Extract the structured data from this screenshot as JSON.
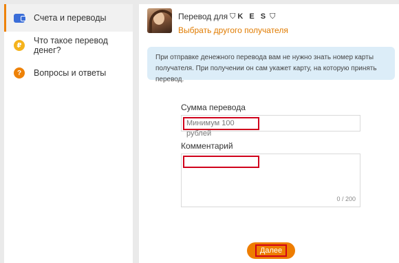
{
  "sidebar": {
    "items": [
      {
        "label": "Счета и переводы",
        "icon": "wallet-icon",
        "active": true
      },
      {
        "label": "Что такое перевод денег?",
        "icon": "ruble-icon",
        "glyph": "₽"
      },
      {
        "label": "Вопросы и ответы",
        "icon": "question-icon",
        "glyph": "?"
      }
    ]
  },
  "recipient": {
    "prefix": "Перевод для",
    "name": "K E S",
    "shield": "⛉",
    "change_link": "Выбрать другого получателя"
  },
  "info_text": "При отправке денежного перевода вам не нужно знать номер карты получателя. При получении он сам укажет карту, на которую принять перевод.",
  "form": {
    "amount_label": "Сумма перевода",
    "amount_placeholder": "Минимум 100 рублей",
    "comment_label": "Комментарий",
    "comment_counter": "0 / 200",
    "submit_label": "Далее"
  },
  "colors": {
    "accent": "#ee7d00",
    "link": "#e07b00",
    "highlight": "#d0021b",
    "info_bg": "#dcedf8"
  }
}
